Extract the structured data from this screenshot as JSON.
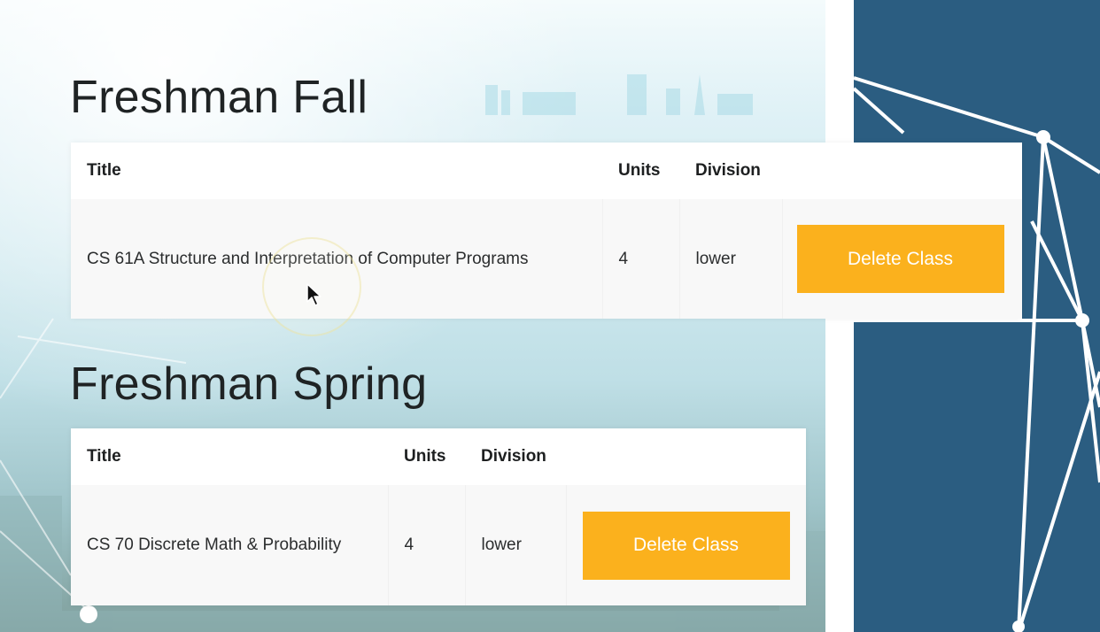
{
  "sections": [
    {
      "heading": "Freshman Fall",
      "columns": {
        "title": "Title",
        "units": "Units",
        "division": "Division"
      },
      "rows": [
        {
          "title": "CS 61A Structure and Interpretation of Computer Programs",
          "units": "4",
          "division": "lower",
          "action_label": "Delete Class"
        }
      ]
    },
    {
      "heading": "Freshman Spring",
      "columns": {
        "title": "Title",
        "units": "Units",
        "division": "Division"
      },
      "rows": [
        {
          "title": "CS 70 Discrete Math & Probability",
          "units": "4",
          "division": "lower",
          "action_label": "Delete Class"
        }
      ]
    }
  ],
  "colors": {
    "button": "#fbb11d",
    "side_panel": "#2b5d81",
    "heading_text": "#1f2324"
  },
  "icons": [
    "mouse-cursor-icon"
  ]
}
